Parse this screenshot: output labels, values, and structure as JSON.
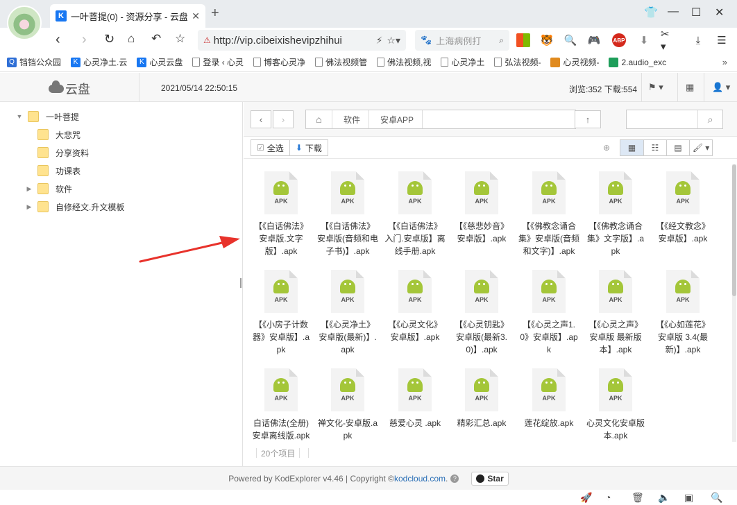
{
  "browser": {
    "tab": {
      "icon": "K",
      "title": "一叶菩提(0) - 资源分享 - 云盘"
    },
    "url": "http://vip.cibeixishevipzhihui",
    "search_placeholder": "上海病例打",
    "bookmarks": [
      {
        "label": "铛铛公众园",
        "icon": "Q",
        "color": "#2f6fd6"
      },
      {
        "label": "心灵净土.云",
        "icon": "K",
        "color": "#1877f2"
      },
      {
        "label": "心灵云盘",
        "icon": "K",
        "color": "#1877f2"
      },
      {
        "label": "登录 ‹ 心灵",
        "icon": "page",
        "color": ""
      },
      {
        "label": "博客心灵净",
        "icon": "page",
        "color": ""
      },
      {
        "label": "佛法视频管",
        "icon": "page",
        "color": ""
      },
      {
        "label": "佛法视频,视",
        "icon": "page",
        "color": ""
      },
      {
        "label": "心灵净土",
        "icon": "page",
        "color": ""
      },
      {
        "label": "弘法视频-",
        "icon": "page",
        "color": ""
      },
      {
        "label": "心灵视频-",
        "icon": "img",
        "color": "#e08a1e"
      },
      {
        "label": "2.audio_exc",
        "icon": "sheet",
        "color": "#1e9e5a"
      }
    ],
    "more": "»"
  },
  "header": {
    "logo": "云盘",
    "datetime": "2021/05/14 22:50:15",
    "stats": "浏览:352 下载:554"
  },
  "tree": {
    "root": "一叶菩提",
    "children": [
      "大悲咒",
      "分享资料",
      "功课表"
    ],
    "collapsed": [
      "软件",
      "自修经文.升文模板"
    ]
  },
  "path": {
    "crumbs": [
      "软件",
      "安卓APP"
    ]
  },
  "toolbar": {
    "select_all": "全选",
    "download": "下载"
  },
  "files": [
    "【《白话佛法》安卓版.文字版】.apk",
    "【《白话佛法》安卓版(音频和电子书)】.apk",
    "【《白话佛法》入门.安卓版】离线手册.apk",
    "【《慈悲妙音》安卓版】.apk",
    "【《佛教念诵合集》安卓版(音频和文字)】.apk",
    "【《佛教念诵合集》文字版】.apk",
    "【《经文教念》安卓版】.apk",
    "【《小房子计数器》安卓版】.apk",
    "【《心灵净土》安卓版(最新)】.apk",
    "【《心灵文化》安卓版】.apk",
    "【《心灵钥匙》安卓版(最新3.0)】.apk",
    "【《心灵之声1.0》安卓版】.apk",
    "【《心灵之声》安卓版 最新版本】.apk",
    "【《心如莲花》安卓版 3.4(最新)】.apk",
    "白话佛法(全册)安卓离线版.apk",
    "禅文化-安卓版.apk",
    "慈爱心灵 .apk",
    "精彩汇总.apk",
    "莲花绽放.apk",
    "心灵文化安卓版本.apk"
  ],
  "apk_label": "APK",
  "status": {
    "count": "20个项目"
  },
  "footer": {
    "powered": "Powered by KodExplorer v4.46 | Copyright © ",
    "link": "kodcloud.com",
    "after": ".",
    "star": "Star"
  }
}
